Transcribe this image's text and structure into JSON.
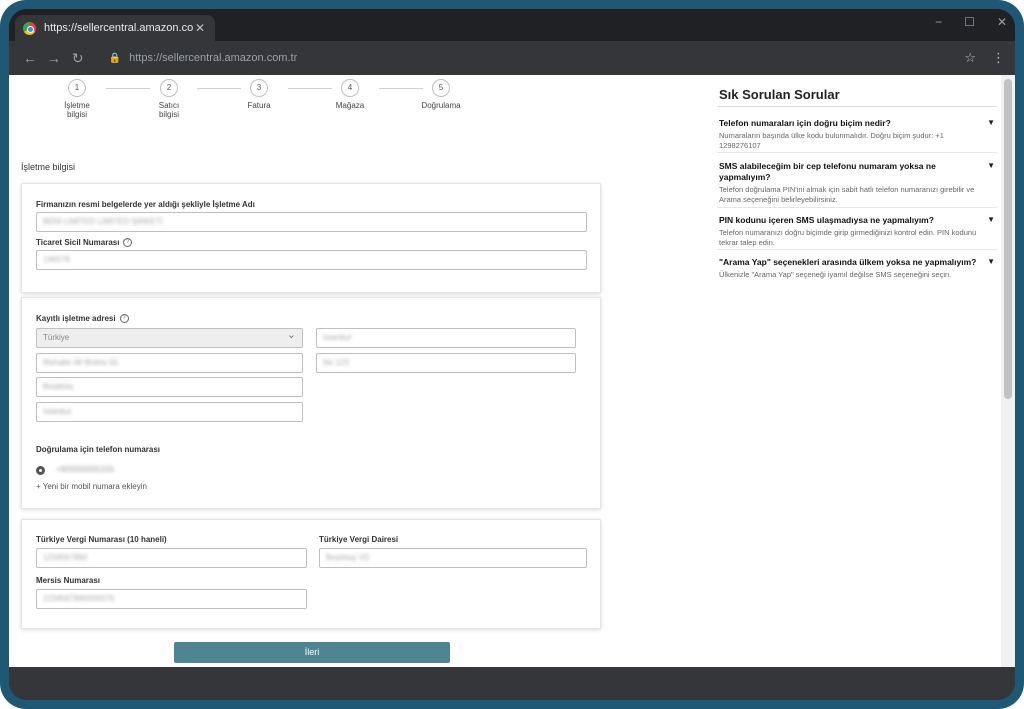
{
  "browser": {
    "tab_title": "https://sellercentral.amazon.com.tr",
    "tab_close": "✕",
    "url": "https://sellercentral.amazon.com.tr",
    "window_controls": [
      "−",
      "☐",
      "✕"
    ]
  },
  "steps": [
    {
      "number": "1",
      "label": "İşletme bilgisi"
    },
    {
      "number": "2",
      "label": "Satıcı bilgisi"
    },
    {
      "number": "3",
      "label": "Fatura"
    },
    {
      "number": "4",
      "label": "Mağaza"
    },
    {
      "number": "5",
      "label": "Doğrulama"
    }
  ],
  "section_title": "İşletme bilgisi",
  "business_card": {
    "name_label": "Firmanızın resmi belgelerde yer aldığı şekliyle İşletme Adı",
    "name_value": "BENİ LIMITED LIMITED ŞIRKETİ",
    "registry_label": "Ticaret Sicil Numarası",
    "registry_value": "146578"
  },
  "address_card": {
    "label": "Kayıtlı işletme adresi",
    "country": "Türkiye",
    "right_top": "Istanbul",
    "street": "Mahalle 48 Blokta 55",
    "right_mid": "No 123",
    "district": "Beşiktaş",
    "city": "İstanbul",
    "phone_label": "Doğrulama için telefon numarası",
    "phone_value": "+905555555155",
    "add_mobile": "+ Yeni bir mobil numara ekleyin"
  },
  "tax_card": {
    "tax_no_label": "Türkiye Vergi Numarası (10 haneli)",
    "tax_no_value": "1234567890",
    "tax_office_label": "Türkiye Vergi Dairesi",
    "tax_office_value": "Beşiktaş VD",
    "mersis_label": "Mersis Numarası",
    "mersis_value": "1234567890000076"
  },
  "submit_label": "İleri",
  "faq": {
    "title": "Sık Sorulan Sorular",
    "items": [
      {
        "q": "Telefon numaraları için doğru biçim nedir?",
        "a": "Numaraların başında ülke kodu bulunmalıdır. Doğru biçim şudur: +1 1298276107"
      },
      {
        "q": "SMS alabileceğim bir cep telefonu numaram yoksa ne yapmalıyım?",
        "a": "Telefon doğrulama PIN'ini almak için sabit hatlı telefon numaranızı girebilir ve Arama seçeneğini belirleyebilirsiniz."
      },
      {
        "q": "PIN kodunu içeren SMS ulaşmadıysa ne yapmalıyım?",
        "a": "Telefon numaranızı doğru biçimde girip girmediğinizi kontrol edin. PIN kodunu tekrar talep edin."
      },
      {
        "q": "\"Arama Yap\" seçenekleri arasında ülkem yoksa ne yapmalıyım?",
        "a": "Ülkenizle \"Arama Yap\" seçeneği iyamıl değilse SMS seçeneğini seçin."
      }
    ]
  }
}
